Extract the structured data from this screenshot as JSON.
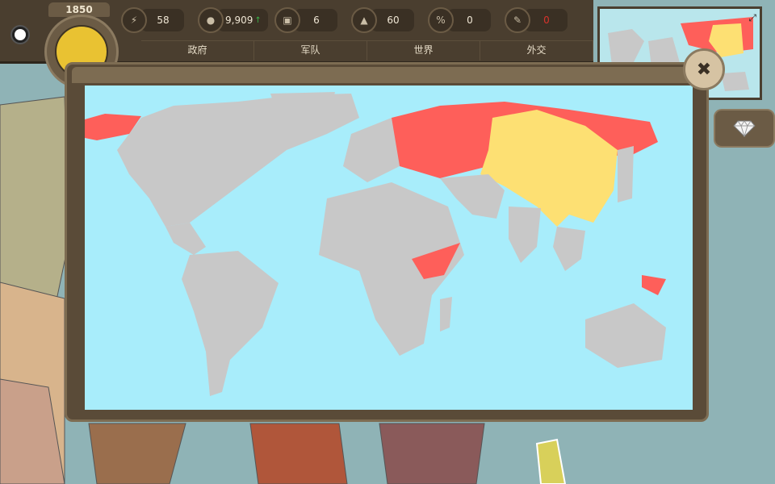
{
  "year": "1850",
  "resources": [
    {
      "icon": "lightning-icon",
      "value": "58"
    },
    {
      "icon": "coins-icon",
      "value": "9,909",
      "trend": "↑"
    },
    {
      "icon": "crate-icon",
      "value": "6"
    },
    {
      "icon": "boot-icon",
      "value": "60"
    },
    {
      "icon": "percent-icon",
      "value": "0"
    },
    {
      "icon": "pen-icon",
      "value": "0"
    }
  ],
  "tabs": [
    "政府",
    "军队",
    "世界",
    "外交"
  ],
  "colors": {
    "ocean": "#a8edfb",
    "land": "#c8c8c8",
    "ally": "#fe5f5a",
    "player": "#fde073",
    "frame": "#5a4b38"
  },
  "icons": {
    "close": "close-icon",
    "expand": "expand-icon",
    "gem": "gem-icon"
  }
}
